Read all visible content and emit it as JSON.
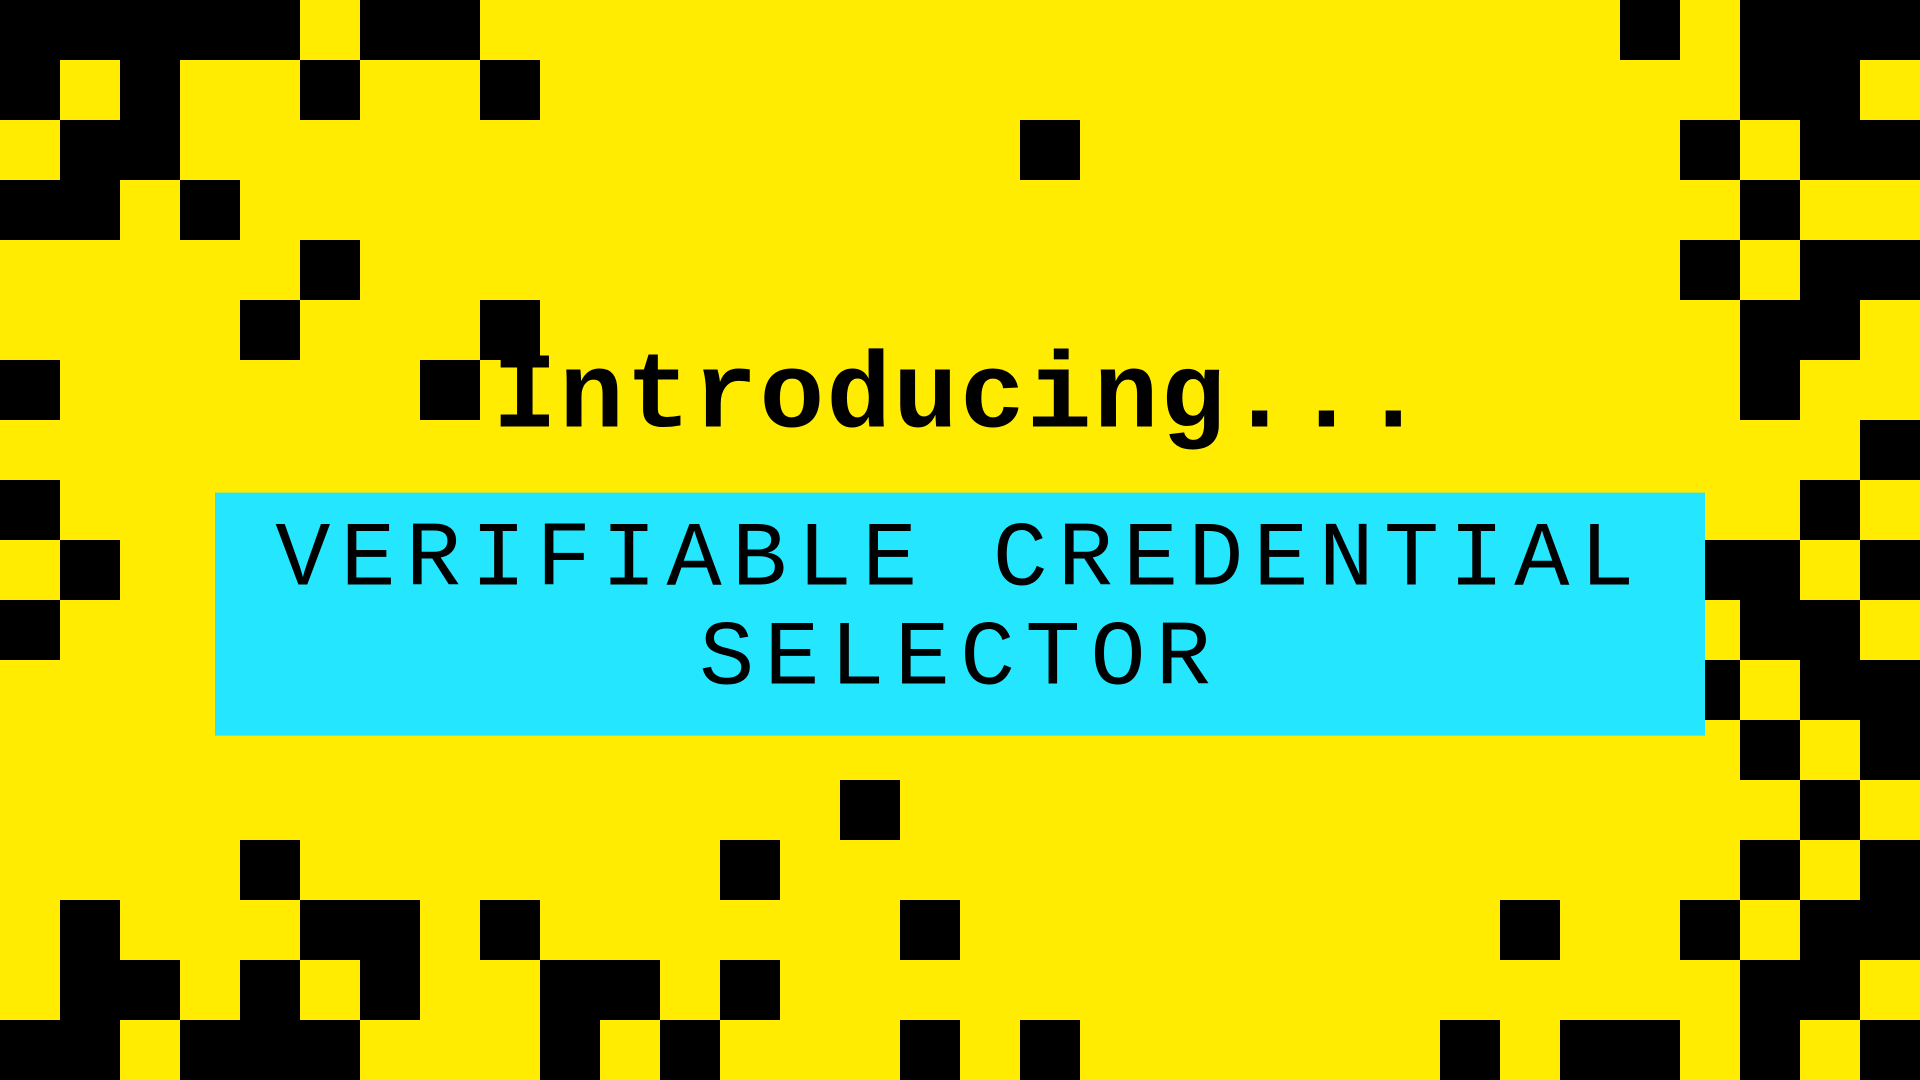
{
  "heading": "Introducing...",
  "title_line1": "VERIFIABLE CREDENTIAL",
  "title_line2": "SELECTOR",
  "colors": {
    "bg": "#ffec00",
    "accent": "#24e7ff",
    "fg": "#000000"
  },
  "pixel_grid": {
    "cols": 32,
    "rows": 18,
    "cells": [
      "11111011000000000000000000010111",
      "10100100100000000000000000000110",
      "01100000000000000100000000001011",
      "11010000000000000000000000000100",
      "00000100000000000000000000001011",
      "00001000100000000000000000000110",
      "10000001000000000000000000000100",
      "00000000000000000000000000000001",
      "10000000000000000000000000000010",
      "01000000000000000000000000001101",
      "10000000000000000000000000000110",
      "00000000000000000000000000001011",
      "00000000000000000000000000000101",
      "00000000000000100000000000000010",
      "00001000000010000000000000000101",
      "01000110100000010000000001001011",
      "01101010011010000000000000000110",
      "11011100010100010100000010110101"
    ]
  }
}
